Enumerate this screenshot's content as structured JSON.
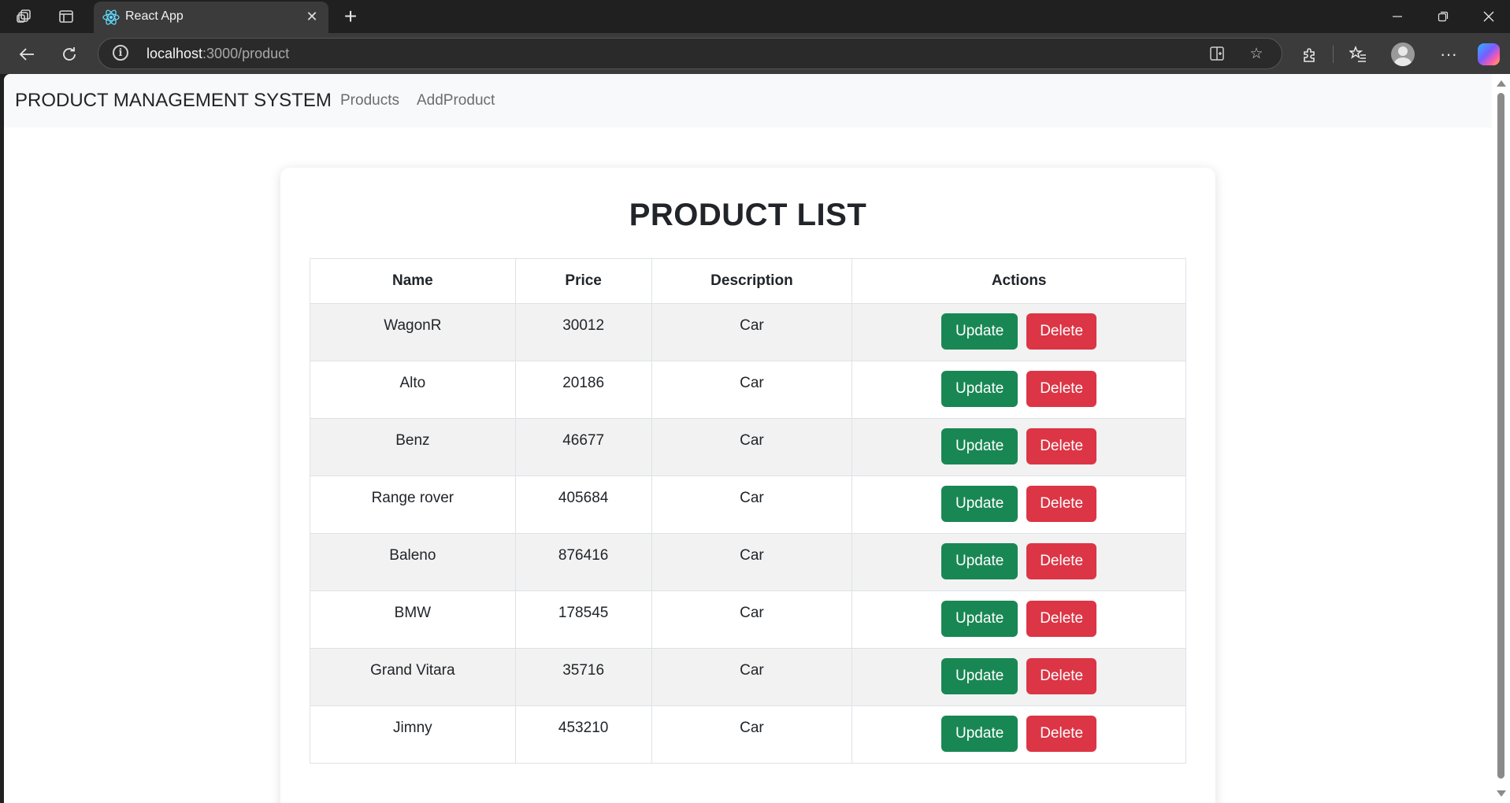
{
  "browser": {
    "tab_title": "React App",
    "url_host": "localhost",
    "url_path": ":3000/product"
  },
  "navbar": {
    "brand": "PRODUCT MANAGEMENT SYSTEM",
    "links": [
      "Products",
      "AddProduct"
    ]
  },
  "product_list": {
    "title": "PRODUCT LIST",
    "columns": [
      "Name",
      "Price",
      "Description",
      "Actions"
    ],
    "rows": [
      {
        "name": "WagonR",
        "price": "30012",
        "description": "Car"
      },
      {
        "name": "Alto",
        "price": "20186",
        "description": "Car"
      },
      {
        "name": "Benz",
        "price": "46677",
        "description": "Car"
      },
      {
        "name": "Range rover",
        "price": "405684",
        "description": "Car"
      },
      {
        "name": "Baleno",
        "price": "876416",
        "description": "Car"
      },
      {
        "name": "BMW",
        "price": "178545",
        "description": "Car"
      },
      {
        "name": "Grand Vitara",
        "price": "35716",
        "description": "Car"
      },
      {
        "name": "Jimny",
        "price": "453210",
        "description": "Car"
      }
    ],
    "update_label": "Update",
    "delete_label": "Delete"
  },
  "colors": {
    "update_button": "#198754",
    "delete_button": "#dc3545",
    "navbar_bg": "#f8f9fa",
    "striped_row": "#f2f2f2"
  },
  "icons": {
    "tab_favicon": "react-icon",
    "workspaces": "workspaces-icon",
    "vertical_tabs": "vertical-tabs-icon",
    "back": "back-arrow-icon",
    "refresh": "refresh-icon",
    "site_info": "info-icon",
    "split_screen": "split-screen-icon",
    "favorite": "star-icon",
    "extensions": "puzzle-icon",
    "favorites_bar": "favorites-icon",
    "profile": "profile-icon",
    "more": "ellipsis-icon",
    "copilot": "copilot-icon"
  }
}
